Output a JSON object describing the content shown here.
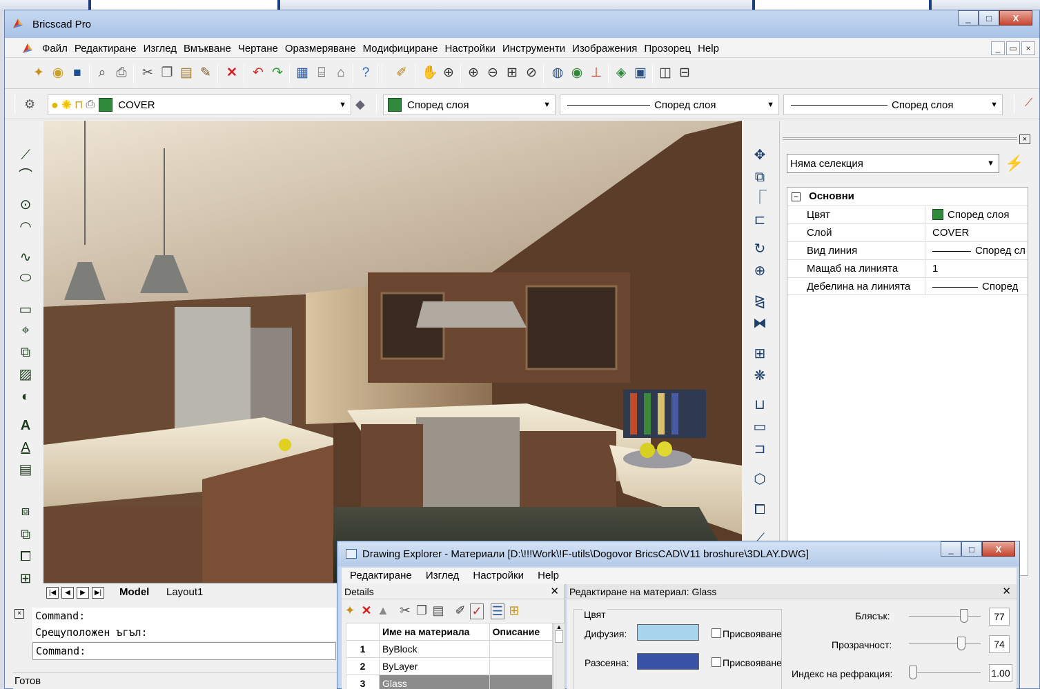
{
  "window": {
    "title": "Bricscad Pro",
    "minimize": "_",
    "maximize": "□",
    "close": "X"
  },
  "menu": {
    "items": [
      "Файл",
      "Редактиране",
      "Изглед",
      "Вмъкване",
      "Чертане",
      "Оразмеряване",
      "Модифициране",
      "Настройки",
      "Инструменти",
      "Изображения",
      "Прозорец",
      "Help"
    ],
    "mdi_min": "_",
    "mdi_restore": "▭",
    "mdi_close": "×"
  },
  "layer_toolbar": {
    "layer_name": "COVER",
    "color_value": "Според слоя",
    "linetype_value": "Според слоя",
    "lineweight_value": "Според слоя"
  },
  "layout_tabs": {
    "tabs": [
      "Model",
      "Layout1"
    ],
    "active": "Model"
  },
  "properties": {
    "selection": "Няма селекция",
    "group_title": "Основни",
    "rows": [
      {
        "key": "Цвят",
        "value": "Според слоя"
      },
      {
        "key": "Слой",
        "value": "COVER"
      },
      {
        "key": "Вид линия",
        "value": "Според сл"
      },
      {
        "key": "Мащаб на линията",
        "value": "1"
      },
      {
        "key": "Дебелина на линията",
        "value": "Според"
      }
    ]
  },
  "command": {
    "history": [
      "Command:",
      "Срещуположен ъгъл:"
    ],
    "prompt": "Command:"
  },
  "status": {
    "text": "Готов"
  },
  "drawing_explorer": {
    "title": "Drawing Explorer - Материали [D:\\!!!Work\\!F-utils\\Dogovor BricsCAD\\V11 broshure\\3DLAY.DWG]",
    "menu": [
      "Редактиране",
      "Изглед",
      "Настройки",
      "Help"
    ],
    "details_title": "Details",
    "columns": [
      "Име на материала",
      "Описание"
    ],
    "rows": [
      {
        "num": "1",
        "name": "ByBlock"
      },
      {
        "num": "2",
        "name": "ByLayer"
      },
      {
        "num": "3",
        "name": "Glass"
      }
    ],
    "editor_title": "Редактиране на материал: Glass",
    "color_group": "Цвят",
    "diffuse_label": "Дифузия:",
    "ambient_label": "Разсеяна:",
    "assign_label": "Присвояване",
    "diffuse_color": "#a8d4ee",
    "ambient_color": "#3852a6",
    "shine_label": "Блясък:",
    "shine_value": "77",
    "transparency_label": "Прозрачност:",
    "transparency_value": "74",
    "refraction_label": "Индекс на рефракция:",
    "refraction_value": "1.00"
  }
}
